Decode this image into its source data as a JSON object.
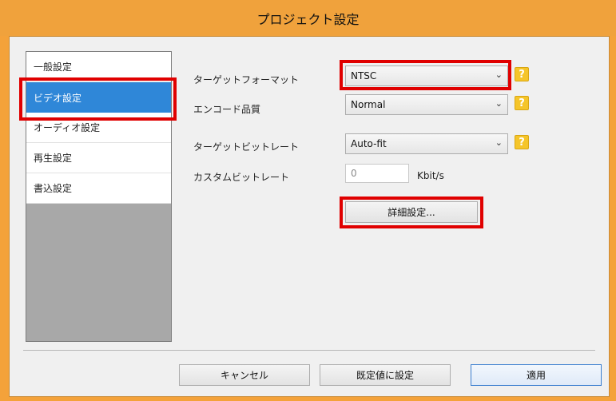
{
  "window": {
    "title": "プロジェクト設定"
  },
  "sidebar": {
    "items": [
      {
        "label": "一般設定",
        "active": false
      },
      {
        "label": "ビデオ設定",
        "active": true
      },
      {
        "label": "オーディオ設定",
        "active": false
      },
      {
        "label": "再生設定",
        "active": false
      },
      {
        "label": "書込設定",
        "active": false
      }
    ]
  },
  "settings": {
    "target_format": {
      "label": "ターゲットフォーマット",
      "value": "NTSC",
      "help": "?"
    },
    "encode_quality": {
      "label": "エンコード品質",
      "value": "Normal",
      "help": "?"
    },
    "target_bitrate": {
      "label": "ターゲットビットレート",
      "value": "Auto-fit",
      "help": "?"
    },
    "custom_bitrate": {
      "label": "カスタムビットレート",
      "value": "0",
      "unit": "Kbit/s"
    },
    "advanced_button": "詳細設定..."
  },
  "footer": {
    "cancel": "キャンセル",
    "set_default": "既定値に設定",
    "apply": "適用"
  },
  "colors": {
    "highlight": "#e00000",
    "selected": "#2f87d8",
    "help": "#f5c52a",
    "frame": "#f0a23c"
  },
  "icons": {
    "dropdown": "chevron-down-icon",
    "help": "help-icon"
  }
}
